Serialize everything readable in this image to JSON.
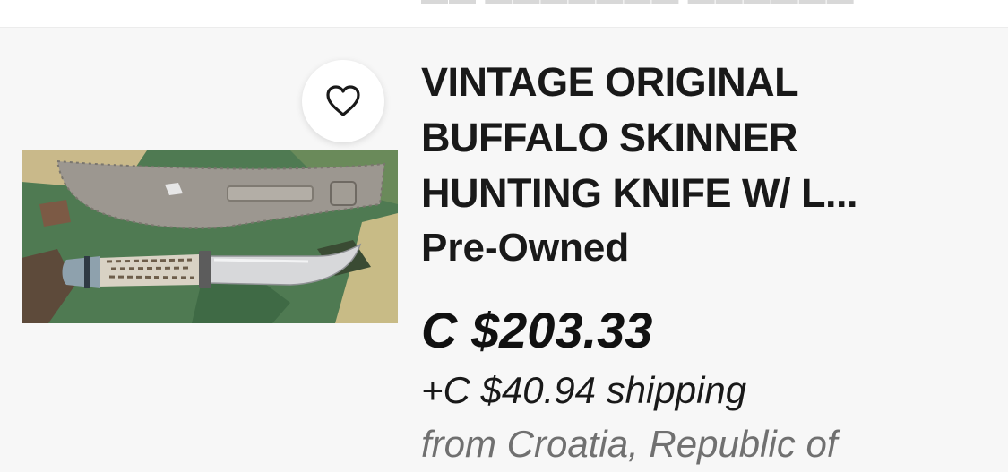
{
  "listing": {
    "title_lines": [
      "VINTAGE ORIGINAL",
      "BUFFALO SKINNER",
      "HUNTING KNIFE W/ L..."
    ],
    "condition": "Pre-Owned",
    "price": "C $203.33",
    "shipping": "+C $40.94 shipping",
    "origin": "from Croatia, Republic of",
    "watch_icon": "heart-icon",
    "image_subject": "hunting-knife-with-sheath-photo"
  },
  "colors": {
    "card_background": "#f7f7f7",
    "text_primary": "#191919",
    "text_secondary": "#707070"
  }
}
